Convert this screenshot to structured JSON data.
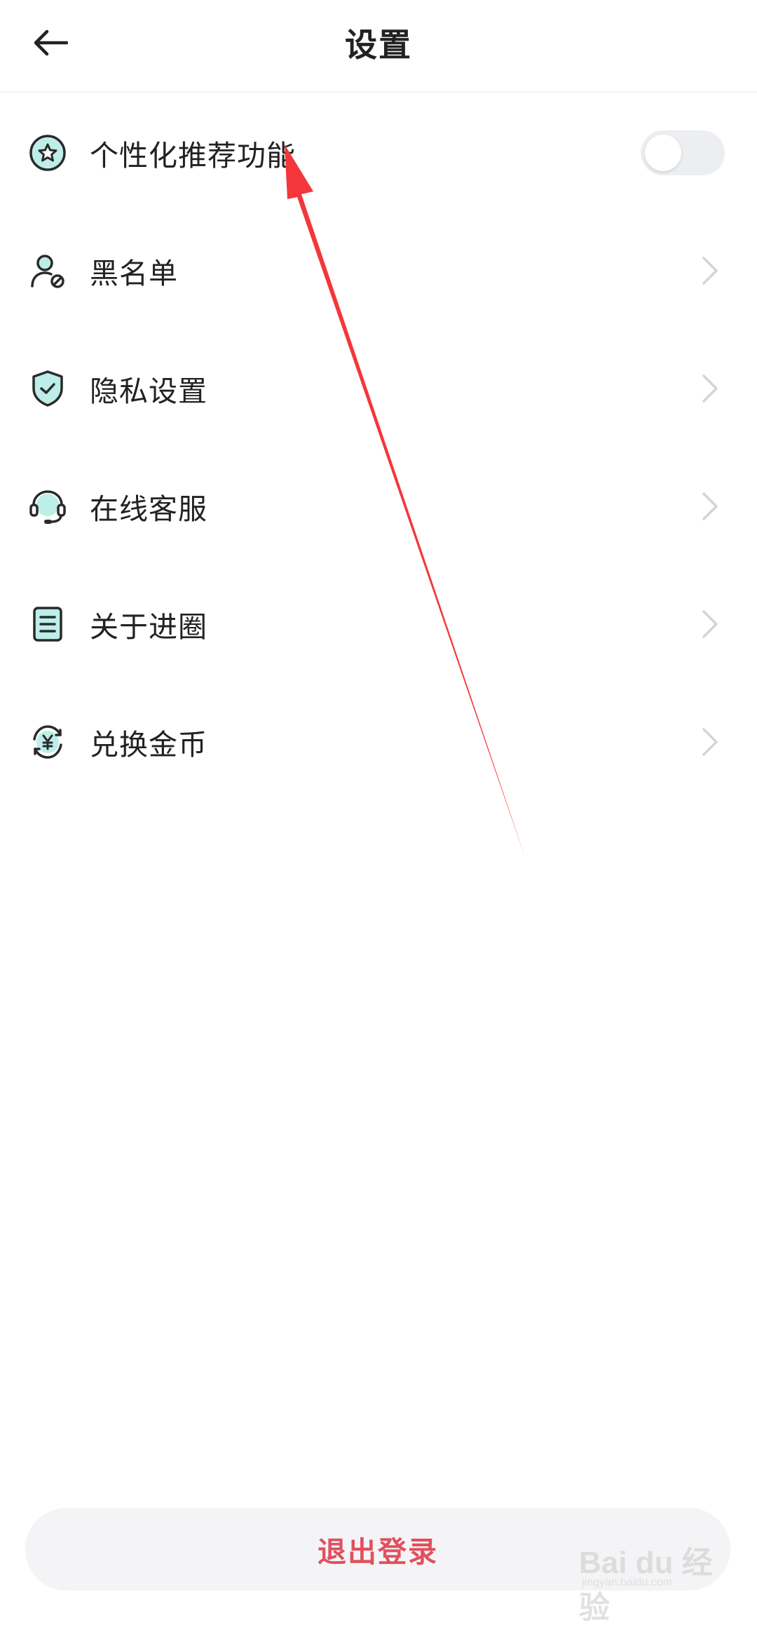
{
  "header": {
    "title": "设置"
  },
  "settings": {
    "items": [
      {
        "label": "个性化推荐功能",
        "icon": "star-badge-icon",
        "control": "toggle",
        "toggle_on": false
      },
      {
        "label": "黑名单",
        "icon": "user-block-icon",
        "control": "chevron"
      },
      {
        "label": "隐私设置",
        "icon": "shield-check-icon",
        "control": "chevron"
      },
      {
        "label": "在线客服",
        "icon": "headset-icon",
        "control": "chevron"
      },
      {
        "label": "关于进圈",
        "icon": "document-icon",
        "control": "chevron"
      },
      {
        "label": "兑换金币",
        "icon": "coin-exchange-icon",
        "control": "chevron"
      }
    ]
  },
  "footer": {
    "logout_label": "退出登录"
  },
  "watermark": {
    "text": "Bai du 经验",
    "sub": "jingyan.baidu.com"
  },
  "colors": {
    "accent": "#5fd3c9",
    "logout_text": "#e0505e",
    "annotation_arrow": "#f4363a"
  }
}
